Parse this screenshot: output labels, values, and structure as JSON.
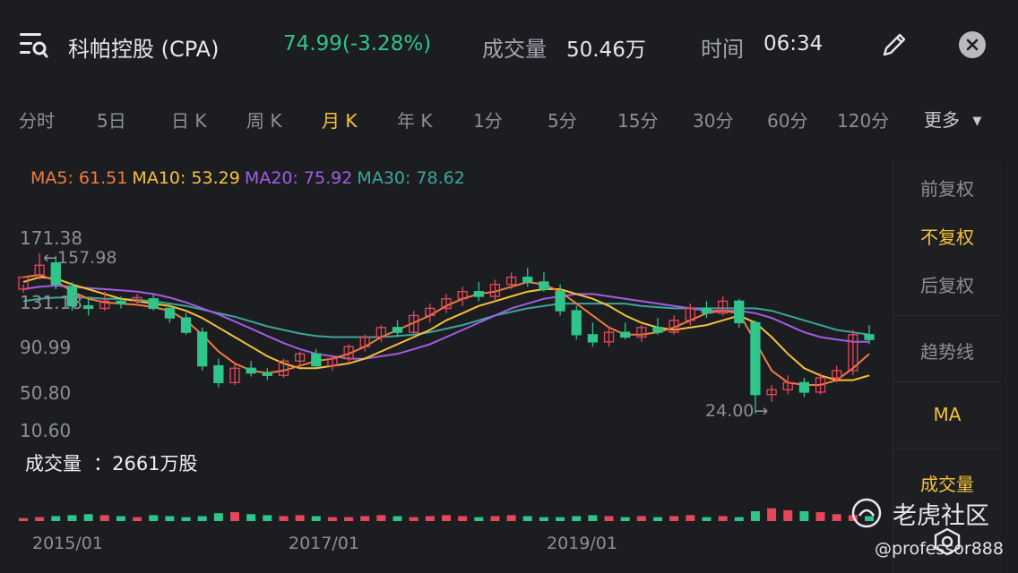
{
  "header": {
    "stock_name": "科帕控股 (CPA)",
    "price": "74.99(-3.28%)",
    "volume_label": "成交量",
    "volume_value": "50.46万",
    "time_label": "时间",
    "time_value": "06:34",
    "icons": {
      "menu": "menu-search-icon",
      "edit": "pencil-icon",
      "close": "close-icon"
    }
  },
  "tabs": [
    {
      "label": "分时"
    },
    {
      "label": "5日"
    },
    {
      "label": "日 K"
    },
    {
      "label": "周 K"
    },
    {
      "label": "月 K",
      "active": true
    },
    {
      "label": "年 K"
    },
    {
      "label": "1分"
    },
    {
      "label": "5分"
    },
    {
      "label": "15分"
    },
    {
      "label": "30分"
    },
    {
      "label": "60分"
    },
    {
      "label": "120分"
    },
    {
      "label": "更多"
    }
  ],
  "ma_legend": {
    "ma5": "MA5: 61.51",
    "ma10": "MA10: 53.29",
    "ma20": "MA20: 75.92",
    "ma30": "MA30: 78.62"
  },
  "colors": {
    "up": "#e8475b",
    "down": "#2fc58b",
    "ma5": "#f07c3e",
    "ma10": "#f5c338",
    "ma20": "#a35ce6",
    "ma30": "#3aa69a",
    "accent": "#f5c338"
  },
  "side_panel": [
    "前复权",
    "不复权",
    "后复权",
    "趋势线",
    "MA",
    "成交量"
  ],
  "side_panel_active": [
    "不复权",
    "MA",
    "成交量"
  ],
  "chart_data": {
    "type": "candlestick",
    "y_ticks": [
      "171.38",
      "131.18",
      "90.99",
      "50.80",
      "10.60"
    ],
    "ylim": [
      10.6,
      171.38
    ],
    "x_ticks": [
      "2015/01",
      "2017/01",
      "2019/01"
    ],
    "annotations": {
      "high": "←157.98",
      "low": "24.00→"
    },
    "candles": [
      {
        "o": 128,
        "h": 132,
        "l": 125,
        "c": 138
      },
      {
        "o": 140,
        "h": 157.98,
        "l": 136,
        "c": 148
      },
      {
        "o": 150,
        "h": 156,
        "l": 128,
        "c": 132
      },
      {
        "o": 130,
        "h": 134,
        "l": 110,
        "c": 114
      },
      {
        "o": 114,
        "h": 120,
        "l": 106,
        "c": 112
      },
      {
        "o": 112,
        "h": 126,
        "l": 110,
        "c": 118
      },
      {
        "o": 118,
        "h": 122,
        "l": 112,
        "c": 116
      },
      {
        "o": 118,
        "h": 124,
        "l": 114,
        "c": 121
      },
      {
        "o": 120,
        "h": 124,
        "l": 110,
        "c": 112
      },
      {
        "o": 112,
        "h": 116,
        "l": 100,
        "c": 104
      },
      {
        "o": 104,
        "h": 108,
        "l": 90,
        "c": 92
      },
      {
        "o": 92,
        "h": 96,
        "l": 60,
        "c": 64
      },
      {
        "o": 64,
        "h": 70,
        "l": 46,
        "c": 50
      },
      {
        "o": 50,
        "h": 66,
        "l": 48,
        "c": 62
      },
      {
        "o": 62,
        "h": 68,
        "l": 55,
        "c": 58
      },
      {
        "o": 58,
        "h": 62,
        "l": 52,
        "c": 56
      },
      {
        "o": 56,
        "h": 70,
        "l": 54,
        "c": 68
      },
      {
        "o": 68,
        "h": 76,
        "l": 64,
        "c": 74
      },
      {
        "o": 74,
        "h": 78,
        "l": 62,
        "c": 64
      },
      {
        "o": 64,
        "h": 72,
        "l": 60,
        "c": 70
      },
      {
        "o": 70,
        "h": 82,
        "l": 66,
        "c": 80
      },
      {
        "o": 80,
        "h": 90,
        "l": 76,
        "c": 88
      },
      {
        "o": 88,
        "h": 98,
        "l": 84,
        "c": 96
      },
      {
        "o": 96,
        "h": 102,
        "l": 88,
        "c": 92
      },
      {
        "o": 92,
        "h": 110,
        "l": 90,
        "c": 106
      },
      {
        "o": 106,
        "h": 116,
        "l": 100,
        "c": 112
      },
      {
        "o": 112,
        "h": 124,
        "l": 108,
        "c": 120
      },
      {
        "o": 120,
        "h": 130,
        "l": 114,
        "c": 126
      },
      {
        "o": 126,
        "h": 134,
        "l": 118,
        "c": 122
      },
      {
        "o": 122,
        "h": 136,
        "l": 118,
        "c": 132
      },
      {
        "o": 132,
        "h": 142,
        "l": 128,
        "c": 138
      },
      {
        "o": 138,
        "h": 146,
        "l": 130,
        "c": 134
      },
      {
        "o": 134,
        "h": 142,
        "l": 126,
        "c": 128
      },
      {
        "o": 126,
        "h": 132,
        "l": 106,
        "c": 110
      },
      {
        "o": 110,
        "h": 114,
        "l": 86,
        "c": 90
      },
      {
        "o": 90,
        "h": 100,
        "l": 80,
        "c": 84
      },
      {
        "o": 84,
        "h": 96,
        "l": 80,
        "c": 92
      },
      {
        "o": 92,
        "h": 100,
        "l": 86,
        "c": 88
      },
      {
        "o": 88,
        "h": 98,
        "l": 84,
        "c": 96
      },
      {
        "o": 96,
        "h": 104,
        "l": 90,
        "c": 92
      },
      {
        "o": 92,
        "h": 106,
        "l": 90,
        "c": 102
      },
      {
        "o": 102,
        "h": 116,
        "l": 98,
        "c": 112
      },
      {
        "o": 112,
        "h": 118,
        "l": 104,
        "c": 108
      },
      {
        "o": 108,
        "h": 122,
        "l": 106,
        "c": 118
      },
      {
        "o": 118,
        "h": 120,
        "l": 96,
        "c": 100
      },
      {
        "o": 100,
        "h": 102,
        "l": 24.0,
        "c": 40
      },
      {
        "o": 40,
        "h": 48,
        "l": 34,
        "c": 44
      },
      {
        "o": 44,
        "h": 56,
        "l": 40,
        "c": 50
      },
      {
        "o": 50,
        "h": 54,
        "l": 38,
        "c": 42
      },
      {
        "o": 42,
        "h": 58,
        "l": 40,
        "c": 54
      },
      {
        "o": 54,
        "h": 64,
        "l": 50,
        "c": 60
      },
      {
        "o": 60,
        "h": 94,
        "l": 56,
        "c": 90
      },
      {
        "o": 90,
        "h": 98,
        "l": 82,
        "c": 86
      }
    ],
    "ma_lines": {
      "ma5": [
        138,
        140,
        135,
        126,
        120,
        117,
        116,
        115,
        113,
        110,
        102,
        90,
        76,
        66,
        60,
        58,
        60,
        64,
        68,
        70,
        74,
        80,
        88,
        94,
        100,
        106,
        114,
        120,
        124,
        126,
        130,
        134,
        132,
        126,
        116,
        106,
        96,
        90,
        90,
        92,
        96,
        102,
        108,
        110,
        108,
        84,
        60,
        50,
        48,
        48,
        52,
        62,
        74
      ],
      "ma10": [
        134,
        138,
        137,
        132,
        128,
        124,
        120,
        118,
        116,
        114,
        110,
        104,
        96,
        88,
        80,
        72,
        66,
        62,
        62,
        64,
        66,
        70,
        76,
        82,
        88,
        94,
        102,
        108,
        114,
        118,
        122,
        126,
        128,
        128,
        124,
        120,
        114,
        106,
        100,
        96,
        94,
        96,
        98,
        102,
        106,
        100,
        88,
        74,
        62,
        56,
        52,
        52,
        56
      ],
      "ma20": [
        128,
        130,
        131,
        130,
        129,
        128,
        127,
        126,
        124,
        121,
        117,
        112,
        107,
        101,
        95,
        89,
        83,
        78,
        74,
        72,
        70,
        70,
        72,
        74,
        78,
        82,
        88,
        94,
        100,
        106,
        112,
        116,
        120,
        122,
        124,
        124,
        122,
        120,
        118,
        116,
        114,
        112,
        110,
        110,
        110,
        108,
        104,
        98,
        92,
        88,
        86,
        84,
        84
      ],
      "ma30": [
        118,
        120,
        121,
        121,
        121,
        120,
        120,
        119,
        118,
        116,
        114,
        111,
        108,
        105,
        101,
        97,
        94,
        91,
        89,
        88,
        88,
        88,
        88,
        89,
        90,
        92,
        95,
        98,
        102,
        106,
        109,
        112,
        114,
        116,
        116,
        116,
        116,
        116,
        114,
        113,
        112,
        112,
        112,
        112,
        112,
        112,
        110,
        106,
        102,
        98,
        94,
        92,
        90
      ]
    },
    "volume": {
      "title": "成交量",
      "value": "：2661万股",
      "bars": [
        3,
        4,
        5,
        6,
        7,
        6,
        5,
        4,
        6,
        5,
        4,
        5,
        8,
        9,
        7,
        6,
        5,
        6,
        5,
        4,
        4,
        5,
        6,
        5,
        4,
        5,
        6,
        5,
        4,
        5,
        6,
        5,
        4,
        4,
        5,
        6,
        5,
        4,
        5,
        4,
        5,
        6,
        4,
        5,
        4,
        10,
        13,
        11,
        10,
        9,
        7,
        6,
        5
      ]
    }
  },
  "watermark": {
    "brand": "老虎社区",
    "handle": "@professor888"
  }
}
